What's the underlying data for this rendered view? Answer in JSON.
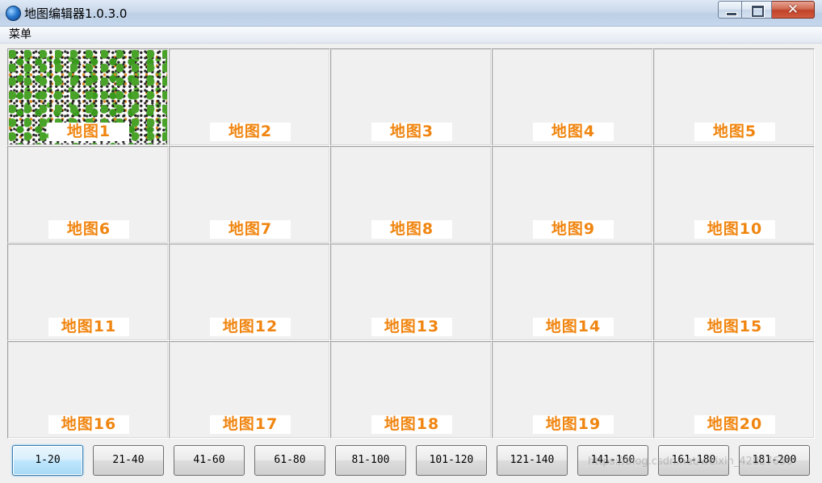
{
  "window": {
    "title": "地图编辑器1.0.3.0"
  },
  "menubar": {
    "items": [
      "菜单"
    ]
  },
  "grid": {
    "tiles": [
      {
        "label": "地图1",
        "has_preview": true
      },
      {
        "label": "地图2",
        "has_preview": false
      },
      {
        "label": "地图3",
        "has_preview": false
      },
      {
        "label": "地图4",
        "has_preview": false
      },
      {
        "label": "地图5",
        "has_preview": false
      },
      {
        "label": "地图6",
        "has_preview": false
      },
      {
        "label": "地图7",
        "has_preview": false
      },
      {
        "label": "地图8",
        "has_preview": false
      },
      {
        "label": "地图9",
        "has_preview": false
      },
      {
        "label": "地图10",
        "has_preview": false
      },
      {
        "label": "地图11",
        "has_preview": false
      },
      {
        "label": "地图12",
        "has_preview": false
      },
      {
        "label": "地图13",
        "has_preview": false
      },
      {
        "label": "地图14",
        "has_preview": false
      },
      {
        "label": "地图15",
        "has_preview": false
      },
      {
        "label": "地图16",
        "has_preview": false
      },
      {
        "label": "地图17",
        "has_preview": false
      },
      {
        "label": "地图18",
        "has_preview": false
      },
      {
        "label": "地图19",
        "has_preview": false
      },
      {
        "label": "地图20",
        "has_preview": false
      }
    ]
  },
  "pager": {
    "buttons": [
      "1-20",
      "21-40",
      "41-60",
      "61-80",
      "81-100",
      "101-120",
      "121-140",
      "141-160",
      "161-180",
      "181-200"
    ],
    "active": "1-20"
  },
  "watermark": "https://blog.csdn.net/weixin_42827656",
  "colors": {
    "label_text": "#f08510",
    "label_bg": "#ffffff",
    "tile_bg": "#f0f0f0",
    "active_button": "#bee6fd"
  },
  "icons": {
    "app": "globe-icon",
    "minimize": "minimize-icon",
    "maximize": "maximize-icon",
    "close": "close-icon"
  }
}
